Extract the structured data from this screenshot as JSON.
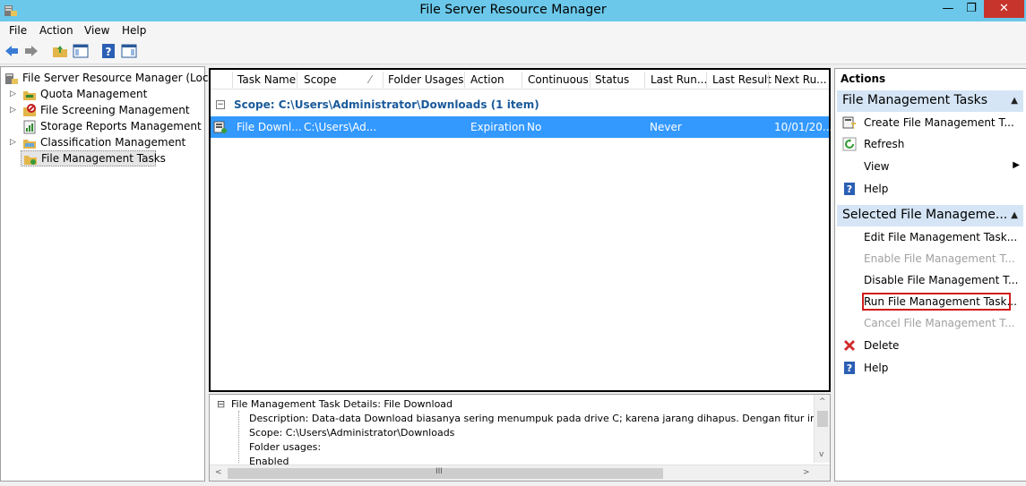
{
  "window": {
    "title": "File Server Resource Manager"
  },
  "window_controls": {
    "minimize": "—",
    "maximize": "❐",
    "close": "✕"
  },
  "menu": [
    "File",
    "Action",
    "View",
    "Help"
  ],
  "toolbar_icons": [
    "back-arrow-icon",
    "forward-arrow-icon",
    "up-folder-icon",
    "show-hide-tree-icon",
    "help-icon",
    "show-hide-action-pane-icon"
  ],
  "tree": {
    "root": "File Server Resource Manager (Local)",
    "items": [
      {
        "label": "Quota Management",
        "expandable": true
      },
      {
        "label": "File Screening Management",
        "expandable": true
      },
      {
        "label": "Storage Reports Management",
        "expandable": false
      },
      {
        "label": "Classification Management",
        "expandable": true
      },
      {
        "label": "File Management Tasks",
        "expandable": false,
        "selected": true
      }
    ]
  },
  "list": {
    "columns": [
      "Task Name",
      "Scope",
      "Folder Usages",
      "Action",
      "Continuous",
      "Status",
      "Last Run...",
      "Last Result",
      "Next Ru..."
    ],
    "sort_indicator": "⁄",
    "group_label": "Scope: C:\\Users\\Administrator\\Downloads (1 item)",
    "group_toggle": "−",
    "rows": [
      {
        "task_name": "File Downl...",
        "scope": "C:\\Users\\Ad...",
        "folder_usages": "",
        "action": "Expiration",
        "continuous": "No",
        "status": "",
        "last_run": "Never",
        "last_result": "",
        "next_run": "10/01/20..."
      }
    ]
  },
  "details": {
    "toggle": "⊟",
    "header": "File Management Task Details: File Download",
    "lines": [
      "Description: Data-data Download biasanya sering menumpuk pada drive C; karena jarang dihapus. Dengan fitur ini kita bisa me manag",
      "Scope: C:\\Users\\Administrator\\Downloads",
      "Folder usages:",
      "Enabled"
    ],
    "scroll_left": "<",
    "scroll_right": ">",
    "scroll_thumb": "III",
    "scroll_up": "^",
    "scroll_down": "v"
  },
  "actions": {
    "title": "Actions",
    "sections": [
      {
        "label": "File Management Tasks",
        "items": [
          {
            "label": "Create File Management T...",
            "icon": "create-task-icon",
            "enabled": true
          },
          {
            "label": "Refresh",
            "icon": "refresh-icon",
            "enabled": true
          },
          {
            "label": "View",
            "icon": "",
            "enabled": true,
            "submenu": true
          },
          {
            "label": "Help",
            "icon": "help-icon",
            "enabled": true
          }
        ]
      },
      {
        "label": "Selected File Manageme...",
        "items": [
          {
            "label": "Edit File Management Task...",
            "icon": "",
            "enabled": true
          },
          {
            "label": "Enable File Management T...",
            "icon": "",
            "enabled": false
          },
          {
            "label": "Disable File Management T...",
            "icon": "",
            "enabled": true
          },
          {
            "label": "Run File Management Task...",
            "icon": "",
            "enabled": true,
            "highlighted": true
          },
          {
            "label": "Cancel File Management T...",
            "icon": "",
            "enabled": false
          },
          {
            "label": "Delete",
            "icon": "delete-icon",
            "enabled": true
          },
          {
            "label": "Help",
            "icon": "help-icon",
            "enabled": true
          }
        ]
      }
    ]
  },
  "colors": {
    "titlebar": "#6bc8ea",
    "close_button": "#c7342c",
    "selection": "#3399ff",
    "group_text": "#1a5a9a",
    "action_section": "#d5e5f5",
    "highlight_box": "#d11b1b"
  }
}
